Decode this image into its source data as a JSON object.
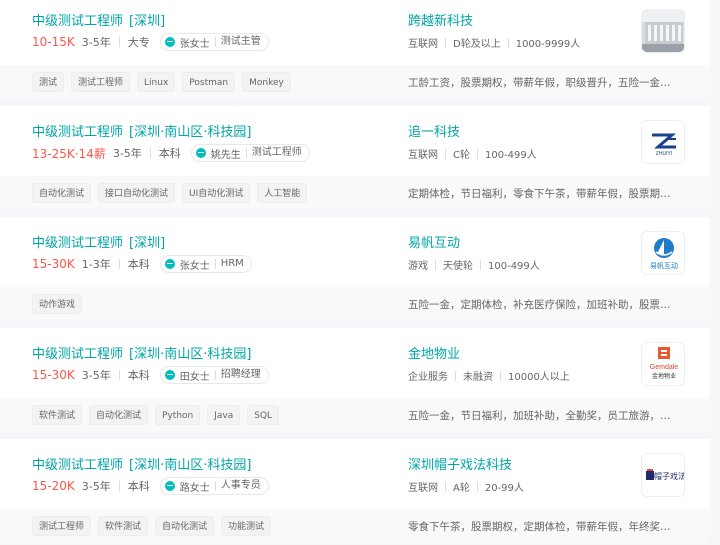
{
  "jobs": [
    {
      "title": "中级测试工程师",
      "area": "[深圳]",
      "salary": "10-15K",
      "experience": "3-5年",
      "degree": "大专",
      "recruiter": "张女士",
      "recruiter_role": "测试主管",
      "company": "跨越新科技",
      "company_info": [
        "互联网",
        "D轮及以上",
        "1000-9999人"
      ],
      "tags": [
        "测试",
        "测试工程师",
        "Linux",
        "Postman",
        "Monkey"
      ],
      "benefits": "工龄工资，股票期权，带薪年假，职级晋升，五险一金，...",
      "logo_icon": "building-photo-logo"
    },
    {
      "title": "中级测试工程师",
      "area": "[深圳·南山区·科技园]",
      "salary": "13-25K·14薪",
      "experience": "3-5年",
      "degree": "本科",
      "recruiter": "姚先生",
      "recruiter_role": "测试工程师",
      "company": "追一科技",
      "company_info": [
        "互联网",
        "C轮",
        "100-499人"
      ],
      "tags": [
        "自动化测试",
        "接口自动化测试",
        "UI自动化测试",
        "人工智能"
      ],
      "benefits": "定期体检，节日福利，零食下午茶，带薪年假，股票期权...",
      "logo_icon": "zhuiyi-logo",
      "logo_text": "ZHUIYI"
    },
    {
      "title": "中级测试工程师",
      "area": "[深圳]",
      "salary": "15-30K",
      "experience": "1-3年",
      "degree": "本科",
      "recruiter": "张女士",
      "recruiter_role": "HRM",
      "company": "易帆互动",
      "company_info": [
        "游戏",
        "天使轮",
        "100-499人"
      ],
      "tags": [
        "动作游戏"
      ],
      "benefits": "五险一金，定期体检，补充医疗保险，加班补助，股票期...",
      "logo_icon": "yifan-logo",
      "logo_text": "易帆互动"
    },
    {
      "title": "中级测试工程师",
      "area": "[深圳·南山区·科技园]",
      "salary": "15-30K",
      "experience": "3-5年",
      "degree": "本科",
      "recruiter": "田女士",
      "recruiter_role": "招聘经理",
      "company": "金地物业",
      "company_info": [
        "企业服务",
        "未融资",
        "10000人以上"
      ],
      "tags": [
        "软件测试",
        "自动化测试",
        "Python",
        "Java",
        "SQL"
      ],
      "benefits": "五险一金，节日福利，加班补助，全勤奖，员工旅游，餐...",
      "logo_icon": "gemdale-logo",
      "logo_text": "Gemdale",
      "logo_subtext": "金地物业"
    },
    {
      "title": "中级测试工程师",
      "area": "[深圳·南山区·科技园]",
      "salary": "15-20K",
      "experience": "3-5年",
      "degree": "本科",
      "recruiter": "路女士",
      "recruiter_role": "人事专员",
      "company": "深圳帽子戏法科技",
      "company_info": [
        "互联网",
        "A轮",
        "20-99人"
      ],
      "tags": [
        "测试工程师",
        "软件测试",
        "自动化测试",
        "功能测试"
      ],
      "benefits": "零食下午茶，股票期权，定期体检，带薪年假，年终奖，...",
      "logo_icon": "maozixifa-logo",
      "logo_text": "帽子戏法"
    }
  ]
}
